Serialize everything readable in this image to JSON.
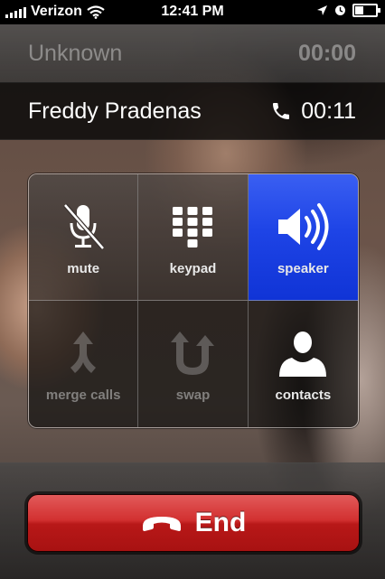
{
  "status_bar": {
    "carrier": "Verizon",
    "time": "12:41 PM",
    "icons": [
      "signal-bars-icon",
      "wifi-icon",
      "location-arrow-icon",
      "alarm-clock-icon",
      "battery-icon"
    ]
  },
  "calls": {
    "held": {
      "name": "Unknown",
      "duration": "00:00"
    },
    "active": {
      "name": "Freddy Pradenas",
      "duration": "00:11",
      "icon": "phone-handset-icon"
    }
  },
  "controls": [
    {
      "label": "mute",
      "icon": "mute-microphone-icon",
      "state": "normal"
    },
    {
      "label": "keypad",
      "icon": "keypad-grid-icon",
      "state": "normal"
    },
    {
      "label": "speaker",
      "icon": "speaker-icon",
      "state": "active"
    },
    {
      "label": "merge calls",
      "icon": "merge-arrows-icon",
      "state": "disabled"
    },
    {
      "label": "swap",
      "icon": "swap-arrows-icon",
      "state": "disabled"
    },
    {
      "label": "contacts",
      "icon": "contact-silhouette-icon",
      "state": "normal"
    }
  ],
  "end_call": {
    "label": "End",
    "icon": "hang-up-icon",
    "color": "#c62828"
  },
  "colors": {
    "active_button": "#1e44e6",
    "end_button": "#c62828",
    "status_bar": "#000000"
  }
}
